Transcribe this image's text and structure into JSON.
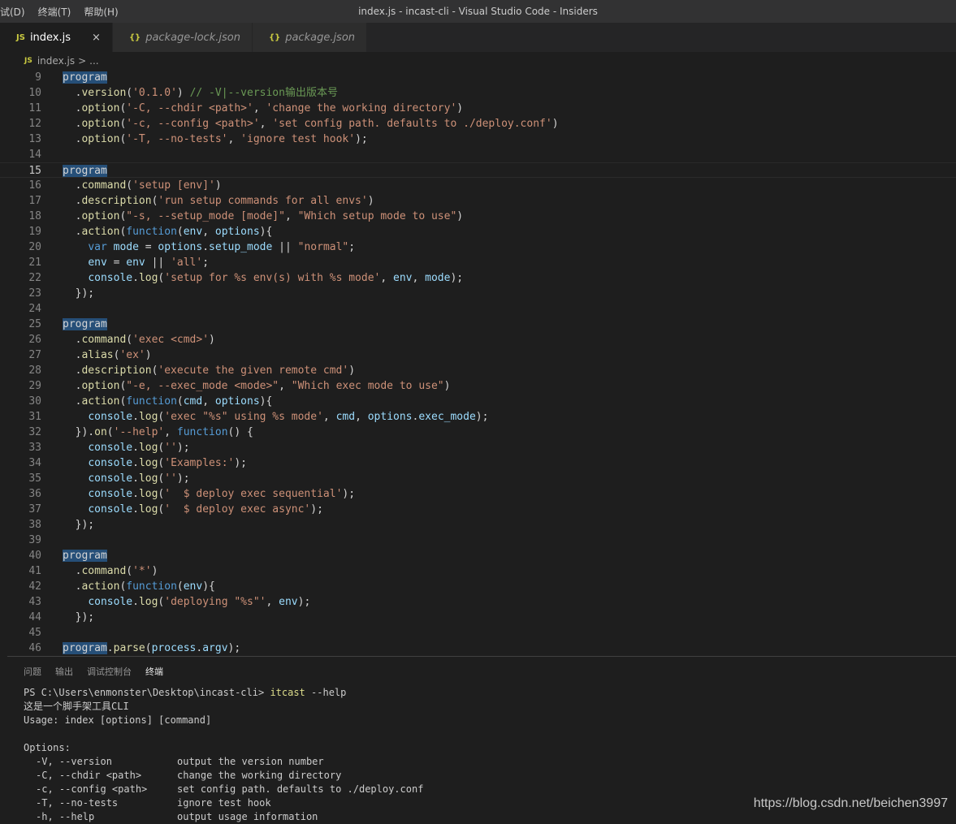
{
  "titlebar": {
    "menu": [
      "试(D)",
      "终端(T)",
      "帮助(H)"
    ],
    "title": "index.js - incast-cli - Visual Studio Code - Insiders"
  },
  "tabs": [
    {
      "icon": "JS",
      "label": "index.js",
      "active": true,
      "close": "×"
    },
    {
      "icon": "{}",
      "label": "package-lock.json"
    },
    {
      "icon": "{}",
      "label": "package.json"
    }
  ],
  "breadcrumb": {
    "icon": "JS",
    "file": "index.js",
    "sep": ">",
    "rest": "..."
  },
  "editor": {
    "current_line": 15,
    "lines": [
      {
        "n": "9",
        "tokens": [
          [
            "hl",
            "program"
          ]
        ]
      },
      {
        "n": "10",
        "tokens": [
          [
            "p",
            "  ."
          ],
          [
            "fn",
            "version"
          ],
          [
            "p",
            "("
          ],
          [
            "str",
            "'0.1.0'"
          ],
          [
            "p",
            ") "
          ],
          [
            "cm",
            "// -V|--version输出版本号"
          ]
        ]
      },
      {
        "n": "11",
        "tokens": [
          [
            "p",
            "  ."
          ],
          [
            "fn",
            "option"
          ],
          [
            "p",
            "("
          ],
          [
            "str",
            "'-C, --chdir <path>'"
          ],
          [
            "p",
            ", "
          ],
          [
            "str",
            "'change the working directory'"
          ],
          [
            "p",
            ")"
          ]
        ]
      },
      {
        "n": "12",
        "tokens": [
          [
            "p",
            "  ."
          ],
          [
            "fn",
            "option"
          ],
          [
            "p",
            "("
          ],
          [
            "str",
            "'-c, --config <path>'"
          ],
          [
            "p",
            ", "
          ],
          [
            "str",
            "'set config path. defaults to ./deploy.conf'"
          ],
          [
            "p",
            ")"
          ]
        ]
      },
      {
        "n": "13",
        "tokens": [
          [
            "p",
            "  ."
          ],
          [
            "fn",
            "option"
          ],
          [
            "p",
            "("
          ],
          [
            "str",
            "'-T, --no-tests'"
          ],
          [
            "p",
            ", "
          ],
          [
            "str",
            "'ignore test hook'"
          ],
          [
            "p",
            ");"
          ]
        ]
      },
      {
        "n": "14",
        "tokens": []
      },
      {
        "n": "15",
        "tokens": [
          [
            "hl",
            "program"
          ]
        ]
      },
      {
        "n": "16",
        "tokens": [
          [
            "p",
            "  ."
          ],
          [
            "fn",
            "command"
          ],
          [
            "p",
            "("
          ],
          [
            "str",
            "'setup [env]'"
          ],
          [
            "p",
            ")"
          ]
        ]
      },
      {
        "n": "17",
        "tokens": [
          [
            "p",
            "  ."
          ],
          [
            "fn",
            "description"
          ],
          [
            "p",
            "("
          ],
          [
            "str",
            "'run setup commands for all envs'"
          ],
          [
            "p",
            ")"
          ]
        ]
      },
      {
        "n": "18",
        "tokens": [
          [
            "p",
            "  ."
          ],
          [
            "fn",
            "option"
          ],
          [
            "p",
            "("
          ],
          [
            "str",
            "\"-s, --setup_mode [mode]\""
          ],
          [
            "p",
            ", "
          ],
          [
            "str",
            "\"Which setup mode to use\""
          ],
          [
            "p",
            ")"
          ]
        ]
      },
      {
        "n": "19",
        "tokens": [
          [
            "p",
            "  ."
          ],
          [
            "fn",
            "action"
          ],
          [
            "p",
            "("
          ],
          [
            "kw",
            "function"
          ],
          [
            "p",
            "("
          ],
          [
            "var",
            "env"
          ],
          [
            "p",
            ", "
          ],
          [
            "var",
            "options"
          ],
          [
            "p",
            "){"
          ]
        ]
      },
      {
        "n": "20",
        "tokens": [
          [
            "p",
            "    "
          ],
          [
            "kw",
            "var"
          ],
          [
            "p",
            " "
          ],
          [
            "var",
            "mode"
          ],
          [
            "p",
            " = "
          ],
          [
            "var",
            "options"
          ],
          [
            "p",
            "."
          ],
          [
            "var",
            "setup_mode"
          ],
          [
            "p",
            " || "
          ],
          [
            "str",
            "\"normal\""
          ],
          [
            "p",
            ";"
          ]
        ]
      },
      {
        "n": "21",
        "tokens": [
          [
            "p",
            "    "
          ],
          [
            "var",
            "env"
          ],
          [
            "p",
            " = "
          ],
          [
            "var",
            "env"
          ],
          [
            "p",
            " || "
          ],
          [
            "str",
            "'all'"
          ],
          [
            "p",
            ";"
          ]
        ]
      },
      {
        "n": "22",
        "tokens": [
          [
            "p",
            "    "
          ],
          [
            "var",
            "console"
          ],
          [
            "p",
            "."
          ],
          [
            "fn",
            "log"
          ],
          [
            "p",
            "("
          ],
          [
            "str",
            "'setup for %s env(s) with %s mode'"
          ],
          [
            "p",
            ", "
          ],
          [
            "var",
            "env"
          ],
          [
            "p",
            ", "
          ],
          [
            "var",
            "mode"
          ],
          [
            "p",
            ");"
          ]
        ]
      },
      {
        "n": "23",
        "tokens": [
          [
            "p",
            "  });"
          ]
        ]
      },
      {
        "n": "24",
        "tokens": []
      },
      {
        "n": "25",
        "tokens": [
          [
            "hl",
            "program"
          ]
        ]
      },
      {
        "n": "26",
        "tokens": [
          [
            "p",
            "  ."
          ],
          [
            "fn",
            "command"
          ],
          [
            "p",
            "("
          ],
          [
            "str",
            "'exec <cmd>'"
          ],
          [
            "p",
            ")"
          ]
        ]
      },
      {
        "n": "27",
        "tokens": [
          [
            "p",
            "  ."
          ],
          [
            "fn",
            "alias"
          ],
          [
            "p",
            "("
          ],
          [
            "str",
            "'ex'"
          ],
          [
            "p",
            ")"
          ]
        ]
      },
      {
        "n": "28",
        "tokens": [
          [
            "p",
            "  ."
          ],
          [
            "fn",
            "description"
          ],
          [
            "p",
            "("
          ],
          [
            "str",
            "'execute the given remote cmd'"
          ],
          [
            "p",
            ")"
          ]
        ]
      },
      {
        "n": "29",
        "tokens": [
          [
            "p",
            "  ."
          ],
          [
            "fn",
            "option"
          ],
          [
            "p",
            "("
          ],
          [
            "str",
            "\"-e, --exec_mode <mode>\""
          ],
          [
            "p",
            ", "
          ],
          [
            "str",
            "\"Which exec mode to use\""
          ],
          [
            "p",
            ")"
          ]
        ]
      },
      {
        "n": "30",
        "tokens": [
          [
            "p",
            "  ."
          ],
          [
            "fn",
            "action"
          ],
          [
            "p",
            "("
          ],
          [
            "kw",
            "function"
          ],
          [
            "p",
            "("
          ],
          [
            "var",
            "cmd"
          ],
          [
            "p",
            ", "
          ],
          [
            "var",
            "options"
          ],
          [
            "p",
            "){"
          ]
        ]
      },
      {
        "n": "31",
        "tokens": [
          [
            "p",
            "    "
          ],
          [
            "var",
            "console"
          ],
          [
            "p",
            "."
          ],
          [
            "fn",
            "log"
          ],
          [
            "p",
            "("
          ],
          [
            "str",
            "'exec \"%s\" using %s mode'"
          ],
          [
            "p",
            ", "
          ],
          [
            "var",
            "cmd"
          ],
          [
            "p",
            ", "
          ],
          [
            "var",
            "options"
          ],
          [
            "p",
            "."
          ],
          [
            "var",
            "exec_mode"
          ],
          [
            "p",
            ");"
          ]
        ]
      },
      {
        "n": "32",
        "tokens": [
          [
            "p",
            "  })."
          ],
          [
            "fn",
            "on"
          ],
          [
            "p",
            "("
          ],
          [
            "str",
            "'--help'"
          ],
          [
            "p",
            ", "
          ],
          [
            "kw",
            "function"
          ],
          [
            "p",
            "() {"
          ]
        ]
      },
      {
        "n": "33",
        "tokens": [
          [
            "p",
            "    "
          ],
          [
            "var",
            "console"
          ],
          [
            "p",
            "."
          ],
          [
            "fn",
            "log"
          ],
          [
            "p",
            "("
          ],
          [
            "str",
            "''"
          ],
          [
            "p",
            ");"
          ]
        ]
      },
      {
        "n": "34",
        "tokens": [
          [
            "p",
            "    "
          ],
          [
            "var",
            "console"
          ],
          [
            "p",
            "."
          ],
          [
            "fn",
            "log"
          ],
          [
            "p",
            "("
          ],
          [
            "str",
            "'Examples:'"
          ],
          [
            "p",
            ");"
          ]
        ]
      },
      {
        "n": "35",
        "tokens": [
          [
            "p",
            "    "
          ],
          [
            "var",
            "console"
          ],
          [
            "p",
            "."
          ],
          [
            "fn",
            "log"
          ],
          [
            "p",
            "("
          ],
          [
            "str",
            "''"
          ],
          [
            "p",
            ");"
          ]
        ]
      },
      {
        "n": "36",
        "tokens": [
          [
            "p",
            "    "
          ],
          [
            "var",
            "console"
          ],
          [
            "p",
            "."
          ],
          [
            "fn",
            "log"
          ],
          [
            "p",
            "("
          ],
          [
            "str",
            "'  $ deploy exec sequential'"
          ],
          [
            "p",
            ");"
          ]
        ]
      },
      {
        "n": "37",
        "tokens": [
          [
            "p",
            "    "
          ],
          [
            "var",
            "console"
          ],
          [
            "p",
            "."
          ],
          [
            "fn",
            "log"
          ],
          [
            "p",
            "("
          ],
          [
            "str",
            "'  $ deploy exec async'"
          ],
          [
            "p",
            ");"
          ]
        ]
      },
      {
        "n": "38",
        "tokens": [
          [
            "p",
            "  });"
          ]
        ]
      },
      {
        "n": "39",
        "tokens": []
      },
      {
        "n": "40",
        "tokens": [
          [
            "hl",
            "program"
          ]
        ]
      },
      {
        "n": "41",
        "tokens": [
          [
            "p",
            "  ."
          ],
          [
            "fn",
            "command"
          ],
          [
            "p",
            "("
          ],
          [
            "str",
            "'*'"
          ],
          [
            "p",
            ")"
          ]
        ]
      },
      {
        "n": "42",
        "tokens": [
          [
            "p",
            "  ."
          ],
          [
            "fn",
            "action"
          ],
          [
            "p",
            "("
          ],
          [
            "kw",
            "function"
          ],
          [
            "p",
            "("
          ],
          [
            "var",
            "env"
          ],
          [
            "p",
            "){"
          ]
        ]
      },
      {
        "n": "43",
        "tokens": [
          [
            "p",
            "    "
          ],
          [
            "var",
            "console"
          ],
          [
            "p",
            "."
          ],
          [
            "fn",
            "log"
          ],
          [
            "p",
            "("
          ],
          [
            "str",
            "'deploying \"%s\"'"
          ],
          [
            "p",
            ", "
          ],
          [
            "var",
            "env"
          ],
          [
            "p",
            ");"
          ]
        ]
      },
      {
        "n": "44",
        "tokens": [
          [
            "p",
            "  });"
          ]
        ]
      },
      {
        "n": "45",
        "tokens": []
      },
      {
        "n": "46",
        "tokens": [
          [
            "hl",
            "program"
          ],
          [
            "p",
            "."
          ],
          [
            "fn",
            "parse"
          ],
          [
            "p",
            "("
          ],
          [
            "var",
            "process"
          ],
          [
            "p",
            "."
          ],
          [
            "var",
            "argv"
          ],
          [
            "p",
            ");"
          ]
        ]
      }
    ]
  },
  "panel": {
    "tabs": [
      {
        "label": "问题",
        "active": false
      },
      {
        "label": "输出",
        "active": false
      },
      {
        "label": "调试控制台",
        "active": false
      },
      {
        "label": "终端",
        "active": true
      }
    ],
    "terminal": {
      "prompt": "PS C:\\Users\\enmonster\\Desktop\\incast-cli> ",
      "command": "itcast",
      "args": " --help",
      "lines": [
        "这是一个脚手架工具CLI",
        "Usage: index [options] [command]",
        "",
        "Options:"
      ],
      "options": [
        {
          "flag": "-V, --version",
          "desc": "output the version number"
        },
        {
          "flag": "-C, --chdir <path>",
          "desc": "change the working directory"
        },
        {
          "flag": "-c, --config <path>",
          "desc": "set config path. defaults to ./deploy.conf"
        },
        {
          "flag": "-T, --no-tests",
          "desc": "ignore test hook"
        },
        {
          "flag": "-h, --help",
          "desc": "output usage information"
        }
      ]
    }
  },
  "watermark": "https://blog.csdn.net/beichen3997"
}
